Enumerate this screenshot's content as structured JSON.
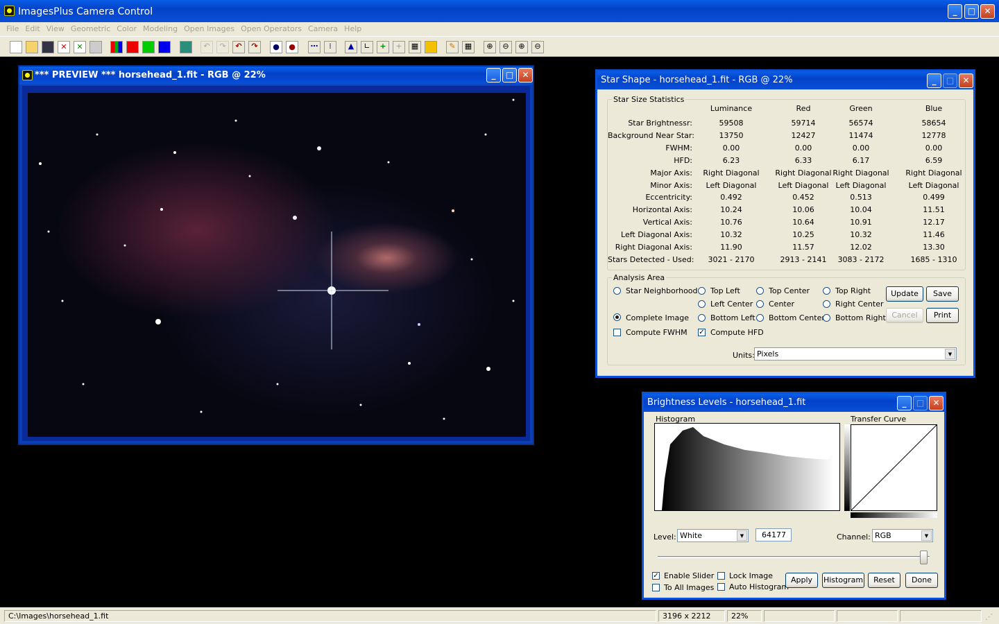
{
  "app": {
    "title": "ImagesPlus Camera Control"
  },
  "menu": [
    "File",
    "Edit",
    "View",
    "Geometric",
    "Color",
    "Modeling",
    "Open Images",
    "Open Operators",
    "Camera",
    "Help"
  ],
  "preview": {
    "title": "*** PREVIEW *** horsehead_1.fit - RGB @ 22%"
  },
  "star": {
    "title": "Star Shape - horsehead_1.fit - RGB @ 22%",
    "group": "Star Size Statistics",
    "columns": [
      "Luminance",
      "Red",
      "Green",
      "Blue"
    ],
    "rows": [
      {
        "label": "Star Brightnessr:",
        "v": [
          "59508",
          "59714",
          "56574",
          "58654"
        ]
      },
      {
        "label": "Background Near Star:",
        "v": [
          "13750",
          "12427",
          "11474",
          "12778"
        ]
      },
      {
        "label": "FWHM:",
        "v": [
          "0.00",
          "0.00",
          "0.00",
          "0.00"
        ]
      },
      {
        "label": "HFD:",
        "v": [
          "6.23",
          "6.33",
          "6.17",
          "6.59"
        ]
      },
      {
        "label": "Major Axis:",
        "v": [
          "Right Diagonal",
          "Right Diagonal",
          "Right Diagonal",
          "Right Diagonal"
        ]
      },
      {
        "label": "Minor Axis:",
        "v": [
          "Left Diagonal",
          "Left Diagonal",
          "Left Diagonal",
          "Left Diagonal"
        ]
      },
      {
        "label": "Eccentricity:",
        "v": [
          "0.492",
          "0.452",
          "0.513",
          "0.499"
        ]
      },
      {
        "label": "Horizontal Axis:",
        "v": [
          "10.24",
          "10.06",
          "10.04",
          "11.51"
        ]
      },
      {
        "label": "Vertical Axis:",
        "v": [
          "10.76",
          "10.64",
          "10.91",
          "12.17"
        ]
      },
      {
        "label": "Left Diagonal Axis:",
        "v": [
          "10.32",
          "10.25",
          "10.32",
          "11.46"
        ]
      },
      {
        "label": "Right Diagonal Axis:",
        "v": [
          "11.90",
          "11.57",
          "12.02",
          "13.30"
        ]
      },
      {
        "label": "Stars Detected - Used:",
        "v": [
          "3021 - 2170",
          "2913 - 2141",
          "3083 - 2172",
          "1685 - 1310"
        ]
      }
    ],
    "analysis": "Analysis Area",
    "options": {
      "star_neighborhood": "Star Neighborhood",
      "complete_image": "Complete Image",
      "top_left": "Top Left",
      "top_center": "Top Center",
      "top_right": "Top Right",
      "left_center": "Left Center",
      "center": "Center",
      "right_center": "Right Center",
      "bottom_left": "Bottom Left",
      "bottom_center": "Bottom Center",
      "bottom_right": "Bottom Right"
    },
    "compute_fwhm": "Compute FWHM",
    "compute_hfd": "Compute HFD",
    "buttons": {
      "update": "Update",
      "save": "Save",
      "cancel": "Cancel",
      "print": "Print"
    },
    "units_label": "Units:",
    "units_value": "Pixels"
  },
  "levels": {
    "title": "Brightness Levels - horsehead_1.fit",
    "histogram_label": "Histogram",
    "curve_label": "Transfer Curve",
    "level_label": "Level:",
    "level_value": "White",
    "level_number": "64177",
    "channel_label": "Channel:",
    "channel_value": "RGB",
    "enable_slider": "Enable Slider",
    "to_all_images": "To All Images",
    "lock_image": "Lock Image",
    "auto_histogram": "Auto Histogram",
    "buttons": {
      "apply": "Apply",
      "histogram": "Histogram",
      "reset": "Reset",
      "done": "Done"
    }
  },
  "status": {
    "path": "C:\\Images\\horsehead_1.fit",
    "dimensions": "3196 x 2212",
    "zoom": "22%"
  }
}
